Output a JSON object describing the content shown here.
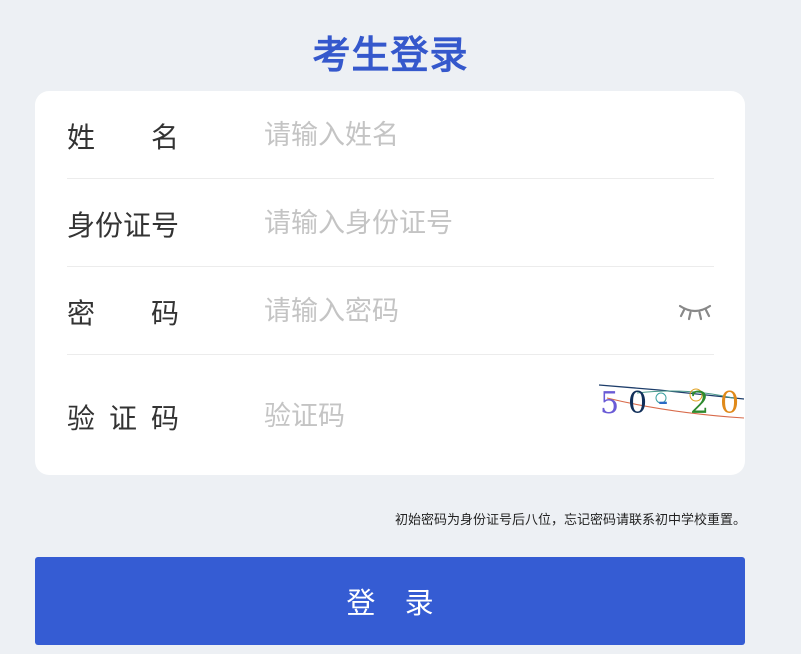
{
  "page": {
    "title": "考生登录"
  },
  "form": {
    "name": {
      "label_chars": [
        "姓",
        "名"
      ],
      "placeholder": "请输入姓名",
      "value": ""
    },
    "id_number": {
      "label": "身份证号",
      "placeholder": "请输入身份证号",
      "value": ""
    },
    "password": {
      "label_chars": [
        "密",
        "码"
      ],
      "placeholder": "请输入密码",
      "value": "",
      "toggle_icon": "eye-closed-icon"
    },
    "captcha": {
      "label_chars": [
        "验",
        "证",
        "码"
      ],
      "placeholder": "验证码",
      "value": "",
      "image_text": [
        "5",
        "0",
        "-",
        "2",
        "0"
      ]
    }
  },
  "hint": "初始密码为身份证号后八位，忘记密码请联系初中学校重置。",
  "login_button": "登 录",
  "colors": {
    "background": "#edf0f4",
    "accent": "#355cd3",
    "title": "#3558cc",
    "card": "#ffffff",
    "placeholder": "#c4c4c4"
  }
}
